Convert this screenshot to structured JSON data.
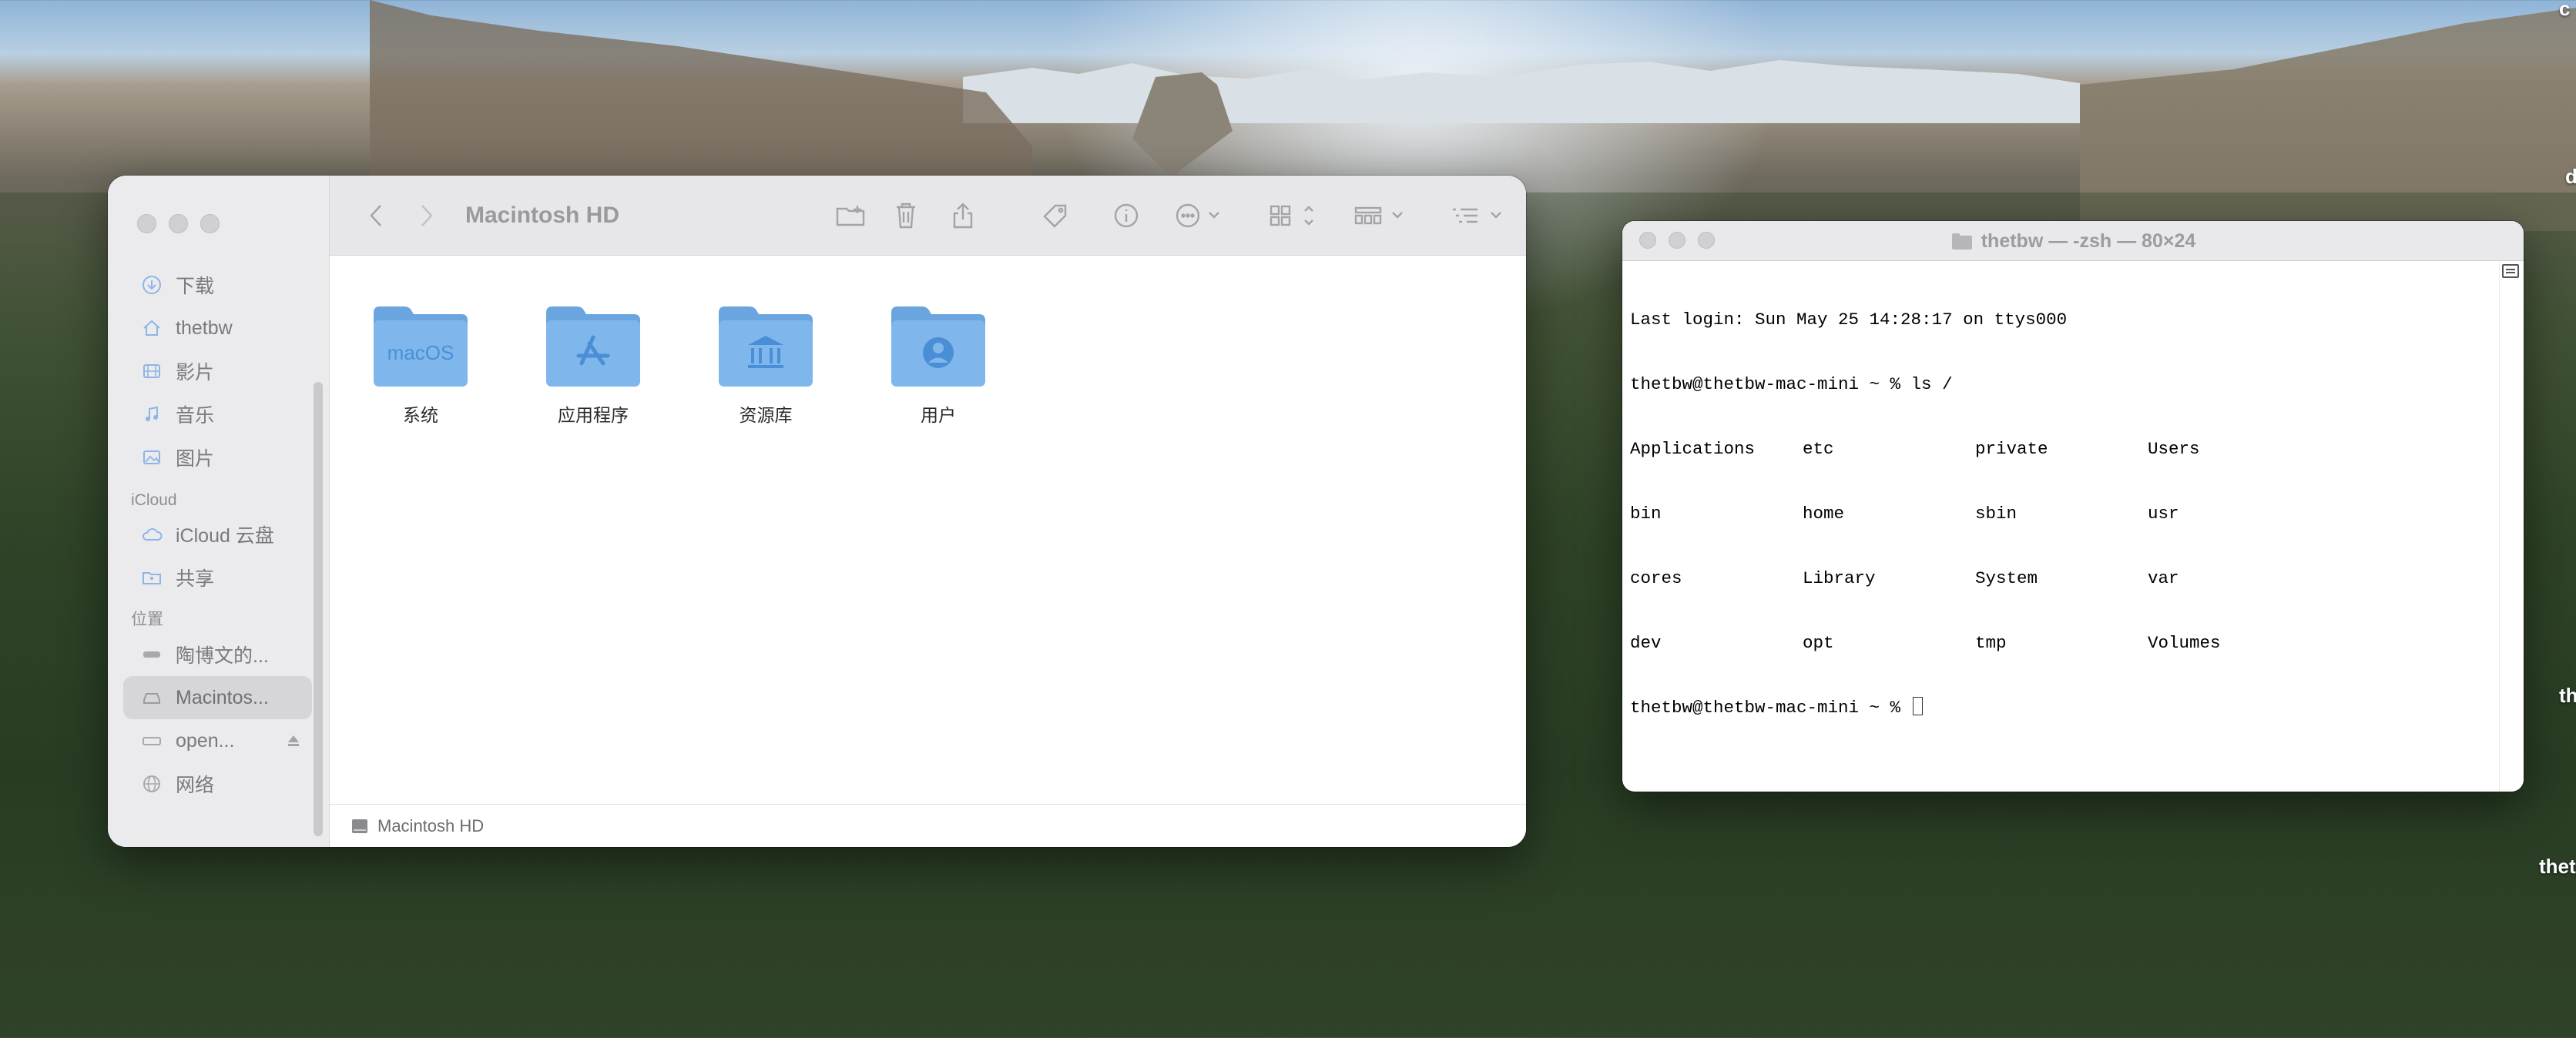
{
  "finder": {
    "title": "Macintosh HD",
    "sidebar": {
      "favorites": [
        {
          "label": "下载",
          "icon": "download-icon"
        },
        {
          "label": "thetbw",
          "icon": "home-icon"
        },
        {
          "label": "影片",
          "icon": "film-icon"
        },
        {
          "label": "音乐",
          "icon": "music-icon"
        },
        {
          "label": "图片",
          "icon": "photo-icon"
        }
      ],
      "icloud_heading": "iCloud",
      "icloud": [
        {
          "label": "iCloud 云盘",
          "icon": "cloud-icon"
        },
        {
          "label": "共享",
          "icon": "shared-folder-icon"
        }
      ],
      "locations_heading": "位置",
      "locations": [
        {
          "label": "陶博文的...",
          "icon": "computer-icon"
        },
        {
          "label": "Macintos...",
          "icon": "hard-drive-icon",
          "selected": true
        },
        {
          "label": "open...",
          "icon": "disk-icon",
          "ejectable": true
        },
        {
          "label": "网络",
          "icon": "network-icon"
        }
      ]
    },
    "folders": [
      {
        "label": "系统",
        "badge": "macOS"
      },
      {
        "label": "应用程序",
        "badge": "app-store-icon"
      },
      {
        "label": "资源库",
        "badge": "library-icon"
      },
      {
        "label": "用户",
        "badge": "user-icon"
      }
    ],
    "pathbar": {
      "label": "Macintosh HD"
    }
  },
  "terminal": {
    "title": "thetbw — -zsh — 80×24",
    "login_line": "Last login: Sun May 25 14:28:17 on ttys000",
    "command_line": "thetbw@thetbw-mac-mini ~ % ls /",
    "listing": [
      [
        "Applications",
        "etc",
        "private",
        "Users"
      ],
      [
        "bin",
        "home",
        "sbin",
        "usr"
      ],
      [
        "cores",
        "Library",
        "System",
        "var"
      ],
      [
        "dev",
        "opt",
        "tmp",
        "Volumes"
      ]
    ],
    "prompt": "thetbw@thetbw-mac-mini ~ % "
  },
  "desktop": {
    "labels": [
      "c",
      "d",
      "th",
      "thet"
    ]
  },
  "colors": {
    "folder_blue": "#7fb7ec",
    "folder_tab": "#6aa5e0",
    "sidebar_bg": "#ebebed",
    "toolbar_bg": "#e7e7e9"
  }
}
